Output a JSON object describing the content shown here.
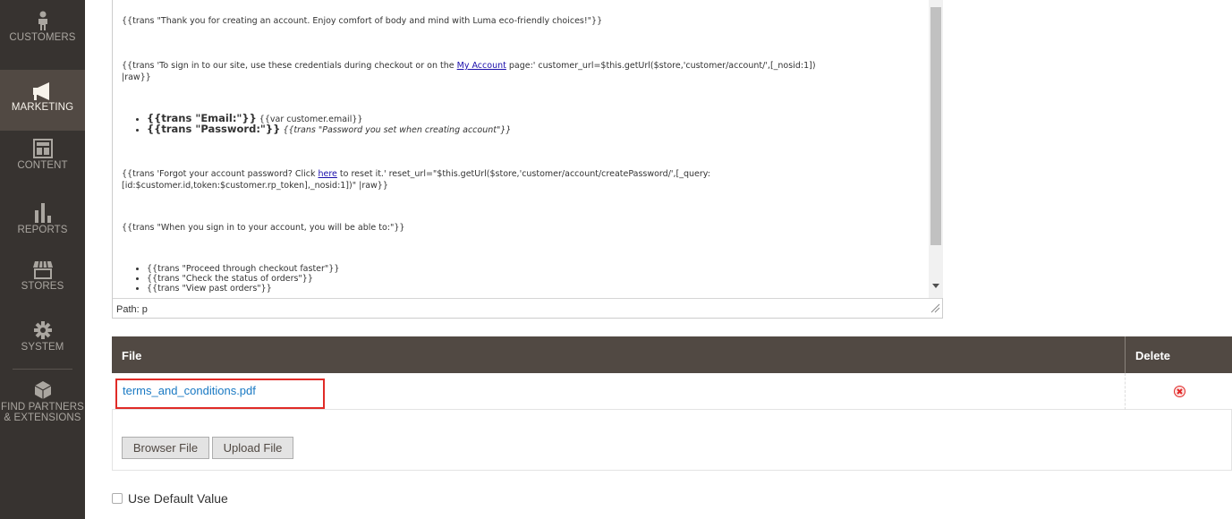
{
  "sidebar": {
    "items": [
      {
        "label": "CUSTOMERS",
        "icon": "person-icon"
      },
      {
        "label": "MARKETING",
        "icon": "megaphone-icon",
        "active": true
      },
      {
        "label": "CONTENT",
        "icon": "layout-icon"
      },
      {
        "label": "REPORTS",
        "icon": "bar-chart-icon"
      },
      {
        "label": "STORES",
        "icon": "storefront-icon"
      },
      {
        "label": "SYSTEM",
        "icon": "gear-icon"
      },
      {
        "label_line1": "FIND PARTNERS",
        "label_line2": "& EXTENSIONS",
        "icon": "cube-icon"
      }
    ]
  },
  "editor": {
    "line1": "{{trans \"Thank you for creating an account. Enjoy comfort of body and mind with Luma eco-friendly choices!\"}}",
    "line2_pre": "{{trans 'To sign in to our site, use these credentials during checkout or on the ",
    "line2_link": "My Account",
    "line2_post": " page:' customer_url=$this.getUrl($store,'customer/account/',[_nosid:1])",
    "line2_cont": "|raw}}",
    "bullet1_bold": "{{trans \"Email:\"}}",
    "bullet1_rest": " {{var customer.email}}",
    "bullet2_bold": "{{trans \"Password:\"}}",
    "bullet2_rest": " {{trans \"Password you set when creating account\"}}",
    "line3_pre": "{{trans 'Forgot your account password? Click ",
    "line3_link": "here",
    "line3_post": " to reset it.' reset_url=\"$this.getUrl($store,'customer/account/createPassword/',[_query:",
    "line3_cont": "[id:$customer.id,token:$customer.rp_token],_nosid:1])\" |raw}}",
    "line4": "{{trans \"When you sign in to your account, you will be able to:\"}}",
    "bullets2": [
      "{{trans \"Proceed through checkout faster\"}}",
      "{{trans \"Check the status of orders\"}}",
      "{{trans \"View past orders\"}}"
    ],
    "path_label": "Path: p"
  },
  "file_table": {
    "col_file": "File",
    "col_delete": "Delete",
    "rows": [
      {
        "filename": "terms_and_conditions.pdf"
      }
    ]
  },
  "buttons": {
    "browse": "Browser File",
    "upload": "Upload File"
  },
  "use_default": {
    "label": "Use Default Value",
    "checked": false
  },
  "colors": {
    "sidebar_bg": "#373330",
    "sidebar_active": "#514943",
    "table_header": "#514943",
    "link": "#1979c3",
    "highlight": "#e02b27",
    "delete": "#e22626"
  }
}
